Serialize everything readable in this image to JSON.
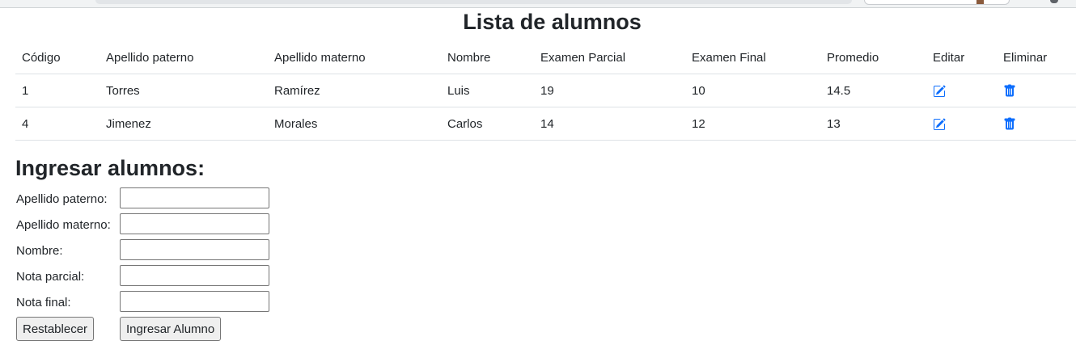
{
  "page": {
    "title": "Lista de alumnos"
  },
  "table": {
    "headers": [
      "Código",
      "Apellido paterno",
      "Apellido materno",
      "Nombre",
      "Examen Parcial",
      "Examen Final",
      "Promedio",
      "Editar",
      "Eliminar"
    ],
    "rows": [
      {
        "codigo": "1",
        "apellido_paterno": "Torres",
        "apellido_materno": "Ramírez",
        "nombre": "Luis",
        "examen_parcial": "19",
        "examen_final": "10",
        "promedio": "14.5"
      },
      {
        "codigo": "4",
        "apellido_paterno": "Jimenez",
        "apellido_materno": "Morales",
        "nombre": "Carlos",
        "examen_parcial": "14",
        "examen_final": "12",
        "promedio": "13"
      }
    ],
    "edit_icon": "pencil-square-icon",
    "delete_icon": "trash-icon",
    "icon_color": "#0d6efd"
  },
  "form": {
    "title": "Ingresar alumnos:",
    "fields": [
      {
        "label": "Apellido paterno:",
        "value": ""
      },
      {
        "label": "Apellido materno:",
        "value": ""
      },
      {
        "label": "Nombre:",
        "value": ""
      },
      {
        "label": "Nota parcial:",
        "value": ""
      },
      {
        "label": "Nota final:",
        "value": ""
      }
    ],
    "reset_label": "Restablecer",
    "submit_label": "Ingresar Alumno"
  }
}
